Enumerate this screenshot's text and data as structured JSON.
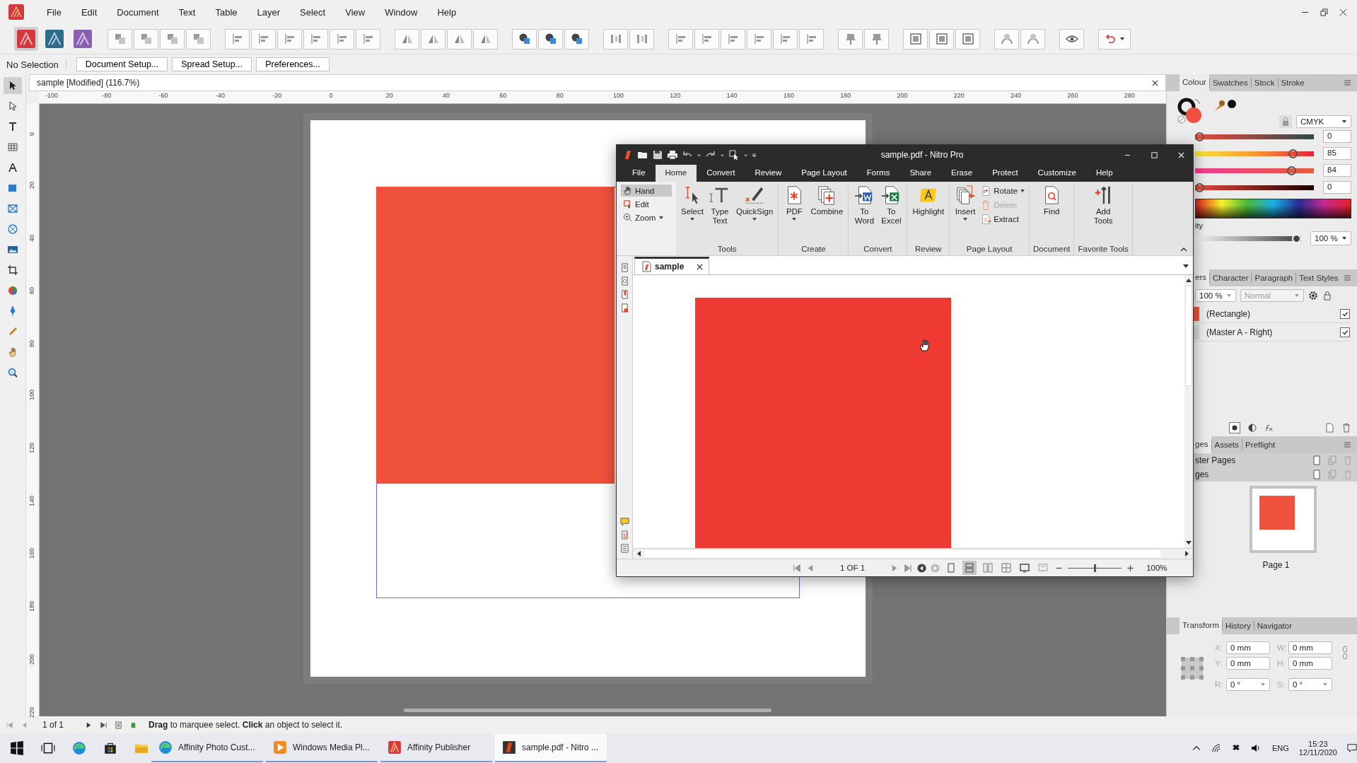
{
  "menu": [
    "File",
    "Edit",
    "Document",
    "Text",
    "Table",
    "Layer",
    "Select",
    "View",
    "Window",
    "Help"
  ],
  "personas": [
    {
      "kind": "publisher",
      "selected": true
    },
    {
      "kind": "designer",
      "selected": false
    },
    {
      "kind": "photo",
      "selected": false
    }
  ],
  "context_bar": {
    "selection": "No Selection",
    "buttons": [
      "Document Setup...",
      "Spread Setup...",
      "Preferences..."
    ]
  },
  "tools": [
    {
      "kind": "move",
      "selected": true
    },
    {
      "kind": "node",
      "selected": false
    },
    {
      "kind": "frame-text",
      "selected": false
    },
    {
      "kind": "table",
      "selected": false
    },
    {
      "kind": "artistic-text",
      "selected": false
    },
    {
      "kind": "rectangle",
      "selected": false
    },
    {
      "kind": "picture-frame",
      "selected": false
    },
    {
      "kind": "ellipse-frame",
      "selected": false
    },
    {
      "kind": "place-image",
      "selected": false
    },
    {
      "kind": "crop",
      "selected": false
    },
    {
      "kind": "fill",
      "selected": false
    },
    {
      "kind": "pen",
      "selected": false
    },
    {
      "kind": "picker",
      "selected": false
    },
    {
      "kind": "hand",
      "selected": false
    },
    {
      "kind": "zoom",
      "selected": false
    }
  ],
  "document_tab": {
    "title": "sample [Modified] (116.7%)"
  },
  "rulers": {
    "horizontal": [
      "-100",
      "-80",
      "-60",
      "-40",
      "-20",
      "0",
      "20",
      "40",
      "60",
      "80",
      "100",
      "120",
      "140",
      "160",
      "180",
      "200",
      "220",
      "240",
      "260",
      "280"
    ],
    "vertical": [
      "0",
      "20",
      "40",
      "60",
      "80",
      "100",
      "120",
      "140",
      "160",
      "180",
      "200",
      "220"
    ]
  },
  "colour_panel": {
    "tabs": [
      {
        "label": "Colour",
        "selected": true
      },
      {
        "label": "Swatches",
        "selected": false
      },
      {
        "label": "Stock",
        "selected": false
      },
      {
        "label": "Stroke",
        "selected": false
      }
    ],
    "mode": "CMYK",
    "channels": [
      {
        "kind": "c",
        "level": 0,
        "reading": "0"
      },
      {
        "kind": "m",
        "level": 0.85,
        "reading": "85"
      },
      {
        "kind": "y",
        "level": 0.84,
        "reading": "84"
      },
      {
        "kind": "k",
        "level": 0,
        "reading": "0"
      }
    ],
    "opacity_label": "ity",
    "opacity": {
      "level": 1,
      "reading": "100 %"
    }
  },
  "layers_panel": {
    "tabs": [
      {
        "label": "ers",
        "selected": true
      },
      {
        "label": "Character",
        "selected": false
      },
      {
        "label": "Paragraph",
        "selected": false
      },
      {
        "label": "Text Styles",
        "selected": false
      }
    ],
    "opacity": "100 %",
    "blend_mode": "Normal",
    "layers": [
      {
        "name": "(Rectangle)",
        "kind": "shape",
        "checked": true
      },
      {
        "name": "(Master A - Right)",
        "kind": "master",
        "checked": true
      }
    ]
  },
  "pages_panel": {
    "tabs": [
      {
        "label": "ges",
        "selected": true
      },
      {
        "label": "Assets",
        "selected": false
      },
      {
        "label": "Preflight",
        "selected": false
      }
    ],
    "sections": [
      "ster Pages",
      "ges"
    ],
    "pages": [
      "Page 1"
    ]
  },
  "transform_panel": {
    "tabs": [
      {
        "label": "Transform",
        "selected": true
      },
      {
        "label": "History",
        "selected": false
      },
      {
        "label": "Navigator",
        "selected": false
      }
    ],
    "fields": [
      {
        "label": "X:",
        "value": "0 mm",
        "kind": "text"
      },
      {
        "label": "W:",
        "value": "0 mm",
        "kind": "text"
      },
      {
        "label": "Y:",
        "value": "0 mm",
        "kind": "text"
      },
      {
        "label": "H:",
        "value": "0 mm",
        "kind": "text"
      },
      {
        "label": "R:",
        "value": "0 °",
        "kind": "dropdown"
      },
      {
        "label": "S:",
        "value": "0 °",
        "kind": "dropdown"
      }
    ]
  },
  "status_bar": {
    "page": "1 of 1",
    "hint": "**Drag** to marquee select. **Click** an object to select it."
  },
  "nitro": {
    "title": "sample.pdf - Nitro Pro",
    "tabs": [
      {
        "label": "File",
        "selected": false
      },
      {
        "label": "Home",
        "selected": true
      },
      {
        "label": "Convert",
        "selected": false
      },
      {
        "label": "Review",
        "selected": false
      },
      {
        "label": "Page Layout",
        "selected": false
      },
      {
        "label": "Forms",
        "selected": false
      },
      {
        "label": "Share",
        "selected": false
      },
      {
        "label": "Erase",
        "selected": false
      },
      {
        "label": "Protect",
        "selected": false
      },
      {
        "label": "Customize",
        "selected": false
      },
      {
        "label": "Help",
        "selected": false
      }
    ],
    "modes": [
      {
        "label": "Hand",
        "kind": "hand",
        "selected": true
      },
      {
        "label": "Edit",
        "kind": "edit",
        "selected": false
      },
      {
        "label": "Zoom",
        "kind": "zoom",
        "selected": false
      }
    ],
    "groups": [
      {
        "label": "Tools",
        "buttons": [
          {
            "label": "Select",
            "kind": "select",
            "dropdown": true,
            "disabled": false
          },
          {
            "label": "Type Text",
            "kind": "type-text",
            "dropdown": false,
            "disabled": false
          },
          {
            "label": "QuickSign",
            "kind": "quicksign",
            "dropdown": true,
            "disabled": false
          }
        ]
      },
      {
        "label": "Create",
        "buttons": [
          {
            "label": "PDF",
            "kind": "pdf",
            "dropdown": true,
            "disabled": false
          },
          {
            "label": "Combine",
            "kind": "combine",
            "dropdown": false,
            "disabled": false
          }
        ]
      },
      {
        "label": "Convert",
        "buttons": [
          {
            "label": "To Word",
            "kind": "word",
            "dropdown": false,
            "disabled": false
          },
          {
            "label": "To Excel",
            "kind": "excel",
            "dropdown": false,
            "disabled": false
          }
        ]
      },
      {
        "label": "Review",
        "buttons": [
          {
            "label": "Highlight",
            "kind": "highlight",
            "dropdown": false,
            "disabled": false
          }
        ]
      },
      {
        "label": "Page Layout",
        "buttons": [
          {
            "label": "Insert",
            "kind": "insert",
            "dropdown": true,
            "disabled": false
          }
        ],
        "small_buttons": [
          {
            "label": "Rotate",
            "kind": "rotate",
            "dropdown": true,
            "disabled": false
          },
          {
            "label": "Delete",
            "kind": "delete",
            "dropdown": false,
            "disabled": true
          },
          {
            "label": "Extract",
            "kind": "extract",
            "dropdown": false,
            "disabled": false
          }
        ]
      },
      {
        "label": "Document",
        "buttons": [
          {
            "label": "Find",
            "kind": "find",
            "dropdown": false,
            "disabled": false
          }
        ]
      },
      {
        "label": "Favorite Tools",
        "buttons": [
          {
            "label": "Add Tools",
            "kind": "add-tools",
            "dropdown": false,
            "disabled": false
          }
        ]
      }
    ],
    "document_tab": "sample",
    "page_indicator": "1 OF 1",
    "views": [
      {
        "kind": "single",
        "selected": false
      },
      {
        "kind": "continuous",
        "selected": true
      },
      {
        "kind": "facing",
        "selected": false
      },
      {
        "kind": "grid",
        "selected": false
      },
      {
        "kind": "fullscreen",
        "selected": false
      },
      {
        "kind": "present",
        "selected": false
      }
    ],
    "zoom": {
      "level": 0.5,
      "reading": "100%"
    }
  },
  "taskbar": {
    "apps": [
      {
        "label": "Affinity Photo Cust...",
        "kind": "edge",
        "selected": false
      },
      {
        "label": "Windows Media Pl...",
        "kind": "media",
        "selected": false
      },
      {
        "label": "Affinity Publisher",
        "kind": "publisher",
        "selected": false
      },
      {
        "label": "sample.pdf - Nitro ...",
        "kind": "nitro",
        "selected": true
      }
    ],
    "language": "ENG",
    "time": "15:23",
    "date": "12/11/2020"
  }
}
